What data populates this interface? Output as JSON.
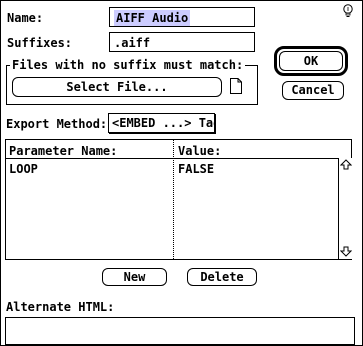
{
  "form": {
    "name_label": "Name:",
    "name_value": "AIFF Audio",
    "suffixes_label": "Suffixes:",
    "suffixes_value": ".aiff"
  },
  "buttons": {
    "ok": "OK",
    "cancel": "Cancel",
    "select_file": "Select File...",
    "new": "New",
    "delete": "Delete"
  },
  "no_suffix_group": {
    "title": "Files with no suffix must match:"
  },
  "export": {
    "label": "Export Method:",
    "selected": "<EMBED ...> Tag"
  },
  "parameters": {
    "columns": [
      "Parameter Name:",
      "Value:"
    ],
    "rows": [
      {
        "name": "LOOP",
        "value": "FALSE"
      }
    ]
  },
  "alternate_html": {
    "label": "Alternate HTML:",
    "value": ""
  },
  "icons": {
    "help": "lightbulb-help-icon",
    "file": "blank-document-icon",
    "scroll_up": "scroll-up-arrow-icon",
    "scroll_down": "scroll-down-arrow-icon"
  }
}
